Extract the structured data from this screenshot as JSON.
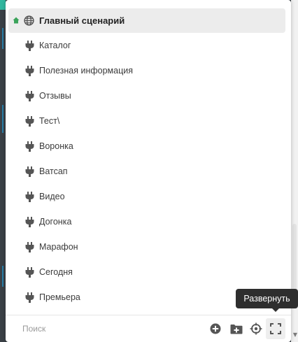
{
  "scenario_list": {
    "main": {
      "label": "Главный сценарий",
      "icons": [
        "home-icon",
        "globe-icon"
      ]
    },
    "items": [
      {
        "label": "Каталог",
        "icon": "plug-icon"
      },
      {
        "label": "Полезная информация",
        "icon": "plug-icon"
      },
      {
        "label": "Отзывы",
        "icon": "plug-icon"
      },
      {
        "label": "Тест\\",
        "icon": "plug-icon"
      },
      {
        "label": "Воронка",
        "icon": "plug-icon"
      },
      {
        "label": "Ватсап",
        "icon": "plug-icon"
      },
      {
        "label": "Видео",
        "icon": "plug-icon"
      },
      {
        "label": "Догонка",
        "icon": "plug-icon"
      },
      {
        "label": "Марафон",
        "icon": "plug-icon"
      },
      {
        "label": "Сегодня",
        "icon": "plug-icon"
      },
      {
        "label": "Премьера",
        "icon": "plug-icon"
      }
    ]
  },
  "footer": {
    "search": {
      "placeholder": "Поиск",
      "value": ""
    },
    "buttons": [
      "add-circle-icon",
      "add-folder-icon",
      "target-icon",
      "expand-icon"
    ]
  },
  "tooltip": {
    "text": "Развернуть"
  },
  "colors": {
    "home_icon": "#3aa35a",
    "icon_gray": "#555555",
    "selected_row_bg": "#ececec",
    "tooltip_bg": "#2e2e2e",
    "canvas_bg": "#2c3338"
  }
}
